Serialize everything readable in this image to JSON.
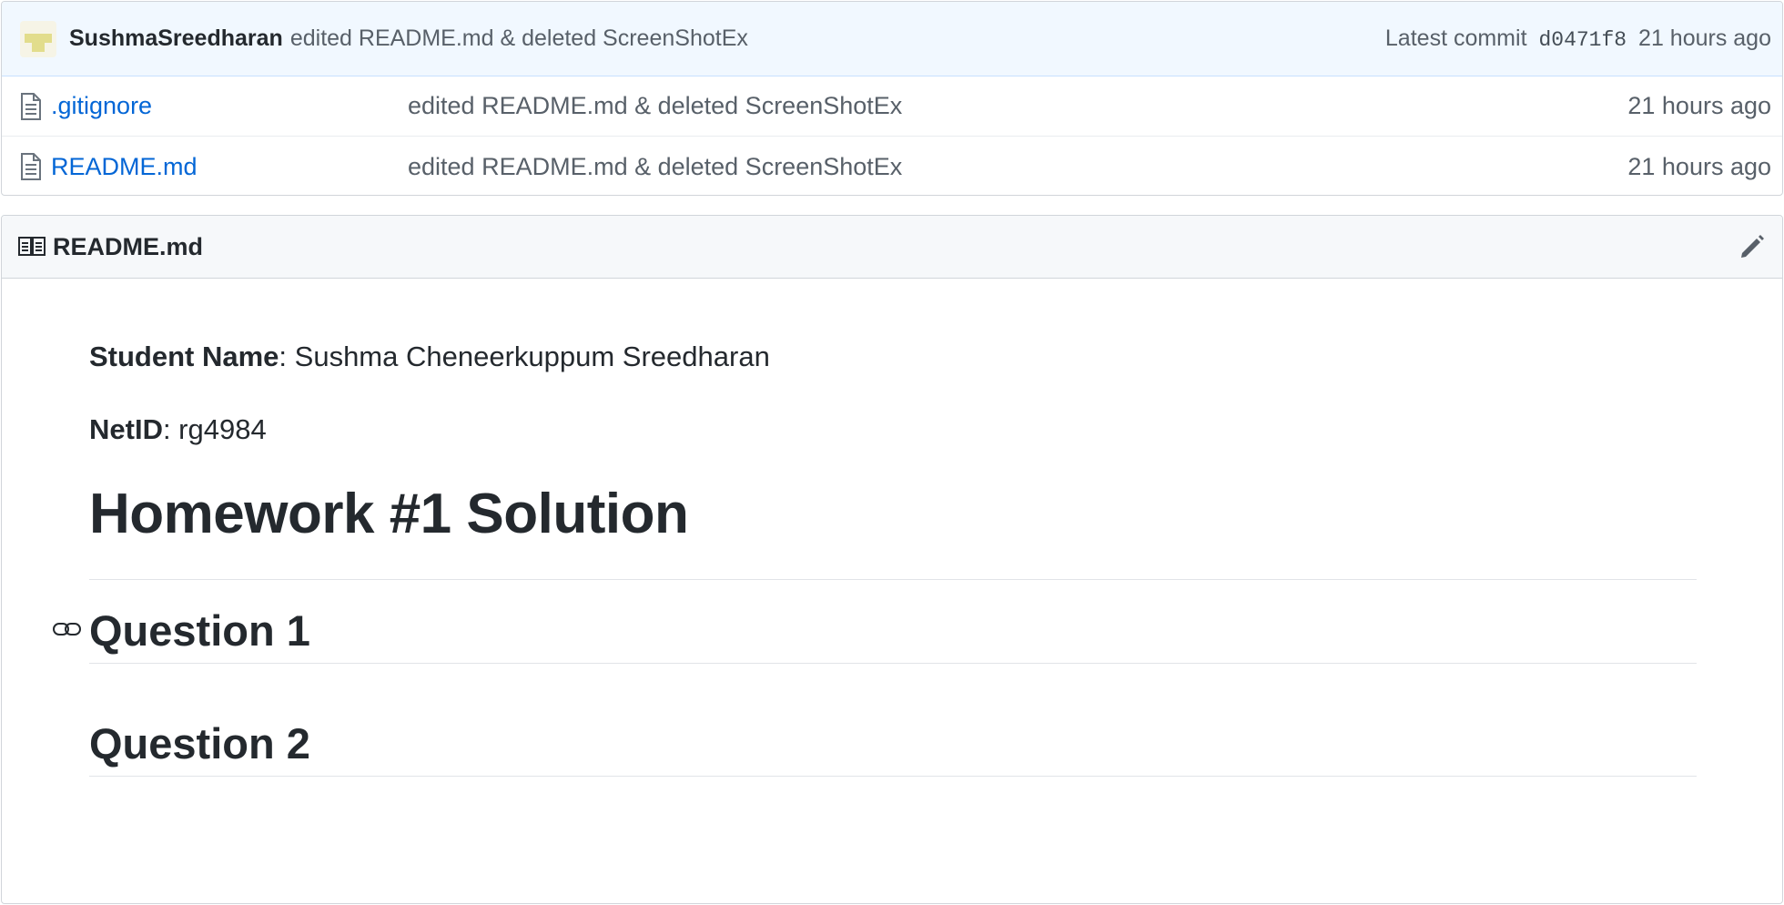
{
  "commit_bar": {
    "author": "SushmaSreedharan",
    "message": "edited README.md & deleted ScreenShotEx",
    "latest_label": "Latest commit",
    "sha": "d0471f8",
    "age": "21 hours ago",
    "avatar_color": "#e2dd8c"
  },
  "files": [
    {
      "icon": "file-icon",
      "name": ".gitignore",
      "commit": "edited README.md & deleted ScreenShotEx",
      "age": "21 hours ago"
    },
    {
      "icon": "file-icon",
      "name": "README.md",
      "commit": "edited README.md & deleted ScreenShotEx",
      "age": "21 hours ago"
    }
  ],
  "readme": {
    "header_icon": "book-icon",
    "title": "README.md",
    "edit_icon": "pencil-icon",
    "student_label": "Student Name",
    "student_value": ": Sushma Cheneerkuppum Sreedharan",
    "netid_label": "NetID",
    "netid_value": ": rg4984",
    "h1": "Homework #1 Solution",
    "sections": [
      "Question 1",
      "Question 2"
    ],
    "anchor_icon": "link-icon"
  },
  "colors": {
    "link": "#0366d6",
    "commit_bar_bg": "#f1f8ff",
    "muted_text": "#586069",
    "text": "#24292e"
  }
}
